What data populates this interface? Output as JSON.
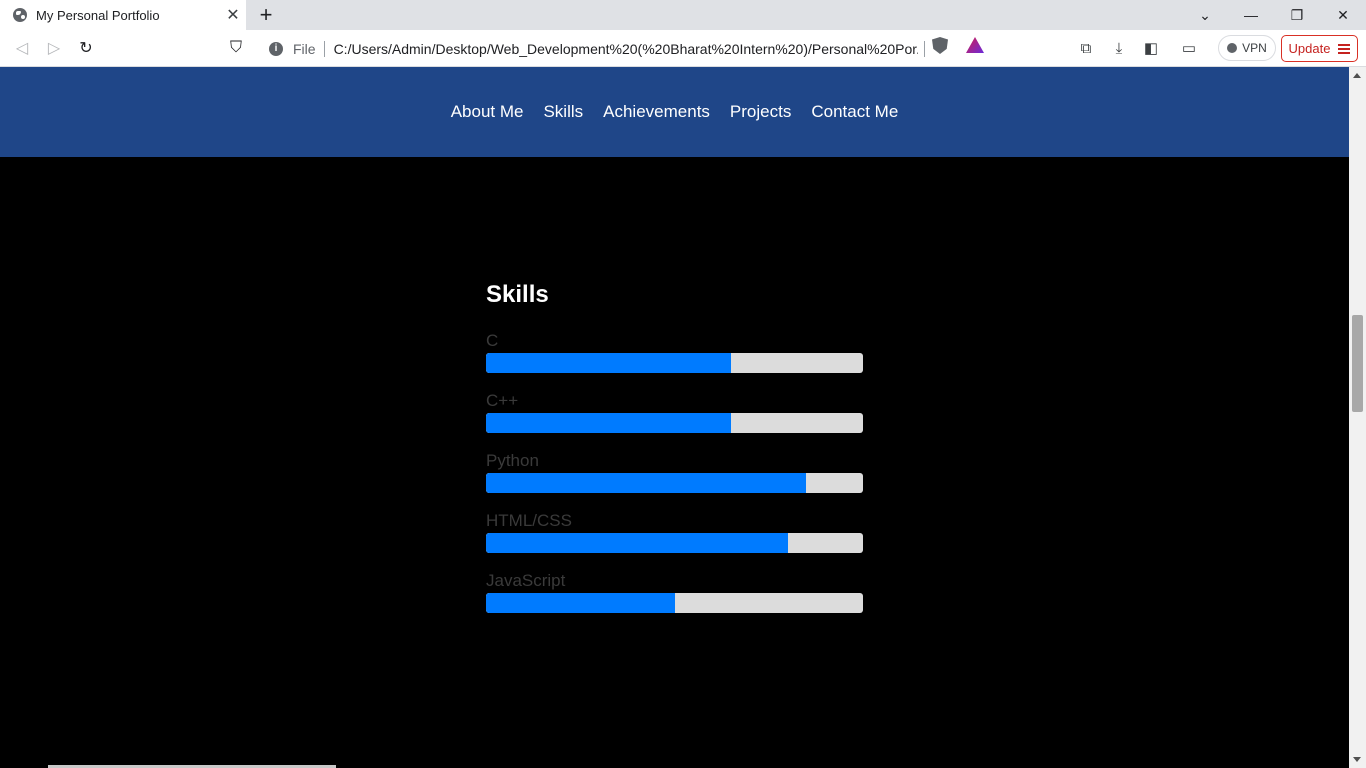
{
  "browser": {
    "tab_title": "My Personal Portfolio",
    "tab_close": "✕",
    "new_tab": "+",
    "file_label": "File",
    "url": "C:/Users/Admin/Desktop/Web_Development%20(%20Bharat%20Intern%20)/Personal%20Por...",
    "vpn_label": "VPN",
    "update_label": "Update",
    "icons": {
      "back": "◁",
      "forward": "▷",
      "reload": "↻",
      "bookmark": "⛉",
      "info": "i",
      "extensions": "⧉",
      "download": "⤓",
      "sidebar": "◧",
      "wallet": "▭",
      "chevron": "⌄",
      "minimize": "—",
      "restore": "❐",
      "close": "✕"
    }
  },
  "nav": {
    "items": [
      "About Me",
      "Skills",
      "Achievements",
      "Projects",
      "Contact Me"
    ]
  },
  "skills": {
    "title": "Skills",
    "items": [
      {
        "name": "C",
        "level": 0.65
      },
      {
        "name": "C++",
        "level": 0.65
      },
      {
        "name": "Python",
        "level": 0.85
      },
      {
        "name": "HTML/CSS",
        "level": 0.8
      },
      {
        "name": "JavaScript",
        "level": 0.5
      }
    ]
  },
  "colors": {
    "nav_bg": "#1f4688",
    "bar_fill": "#007bff",
    "bar_track": "#dcdcdc",
    "page_bg": "#000000"
  }
}
